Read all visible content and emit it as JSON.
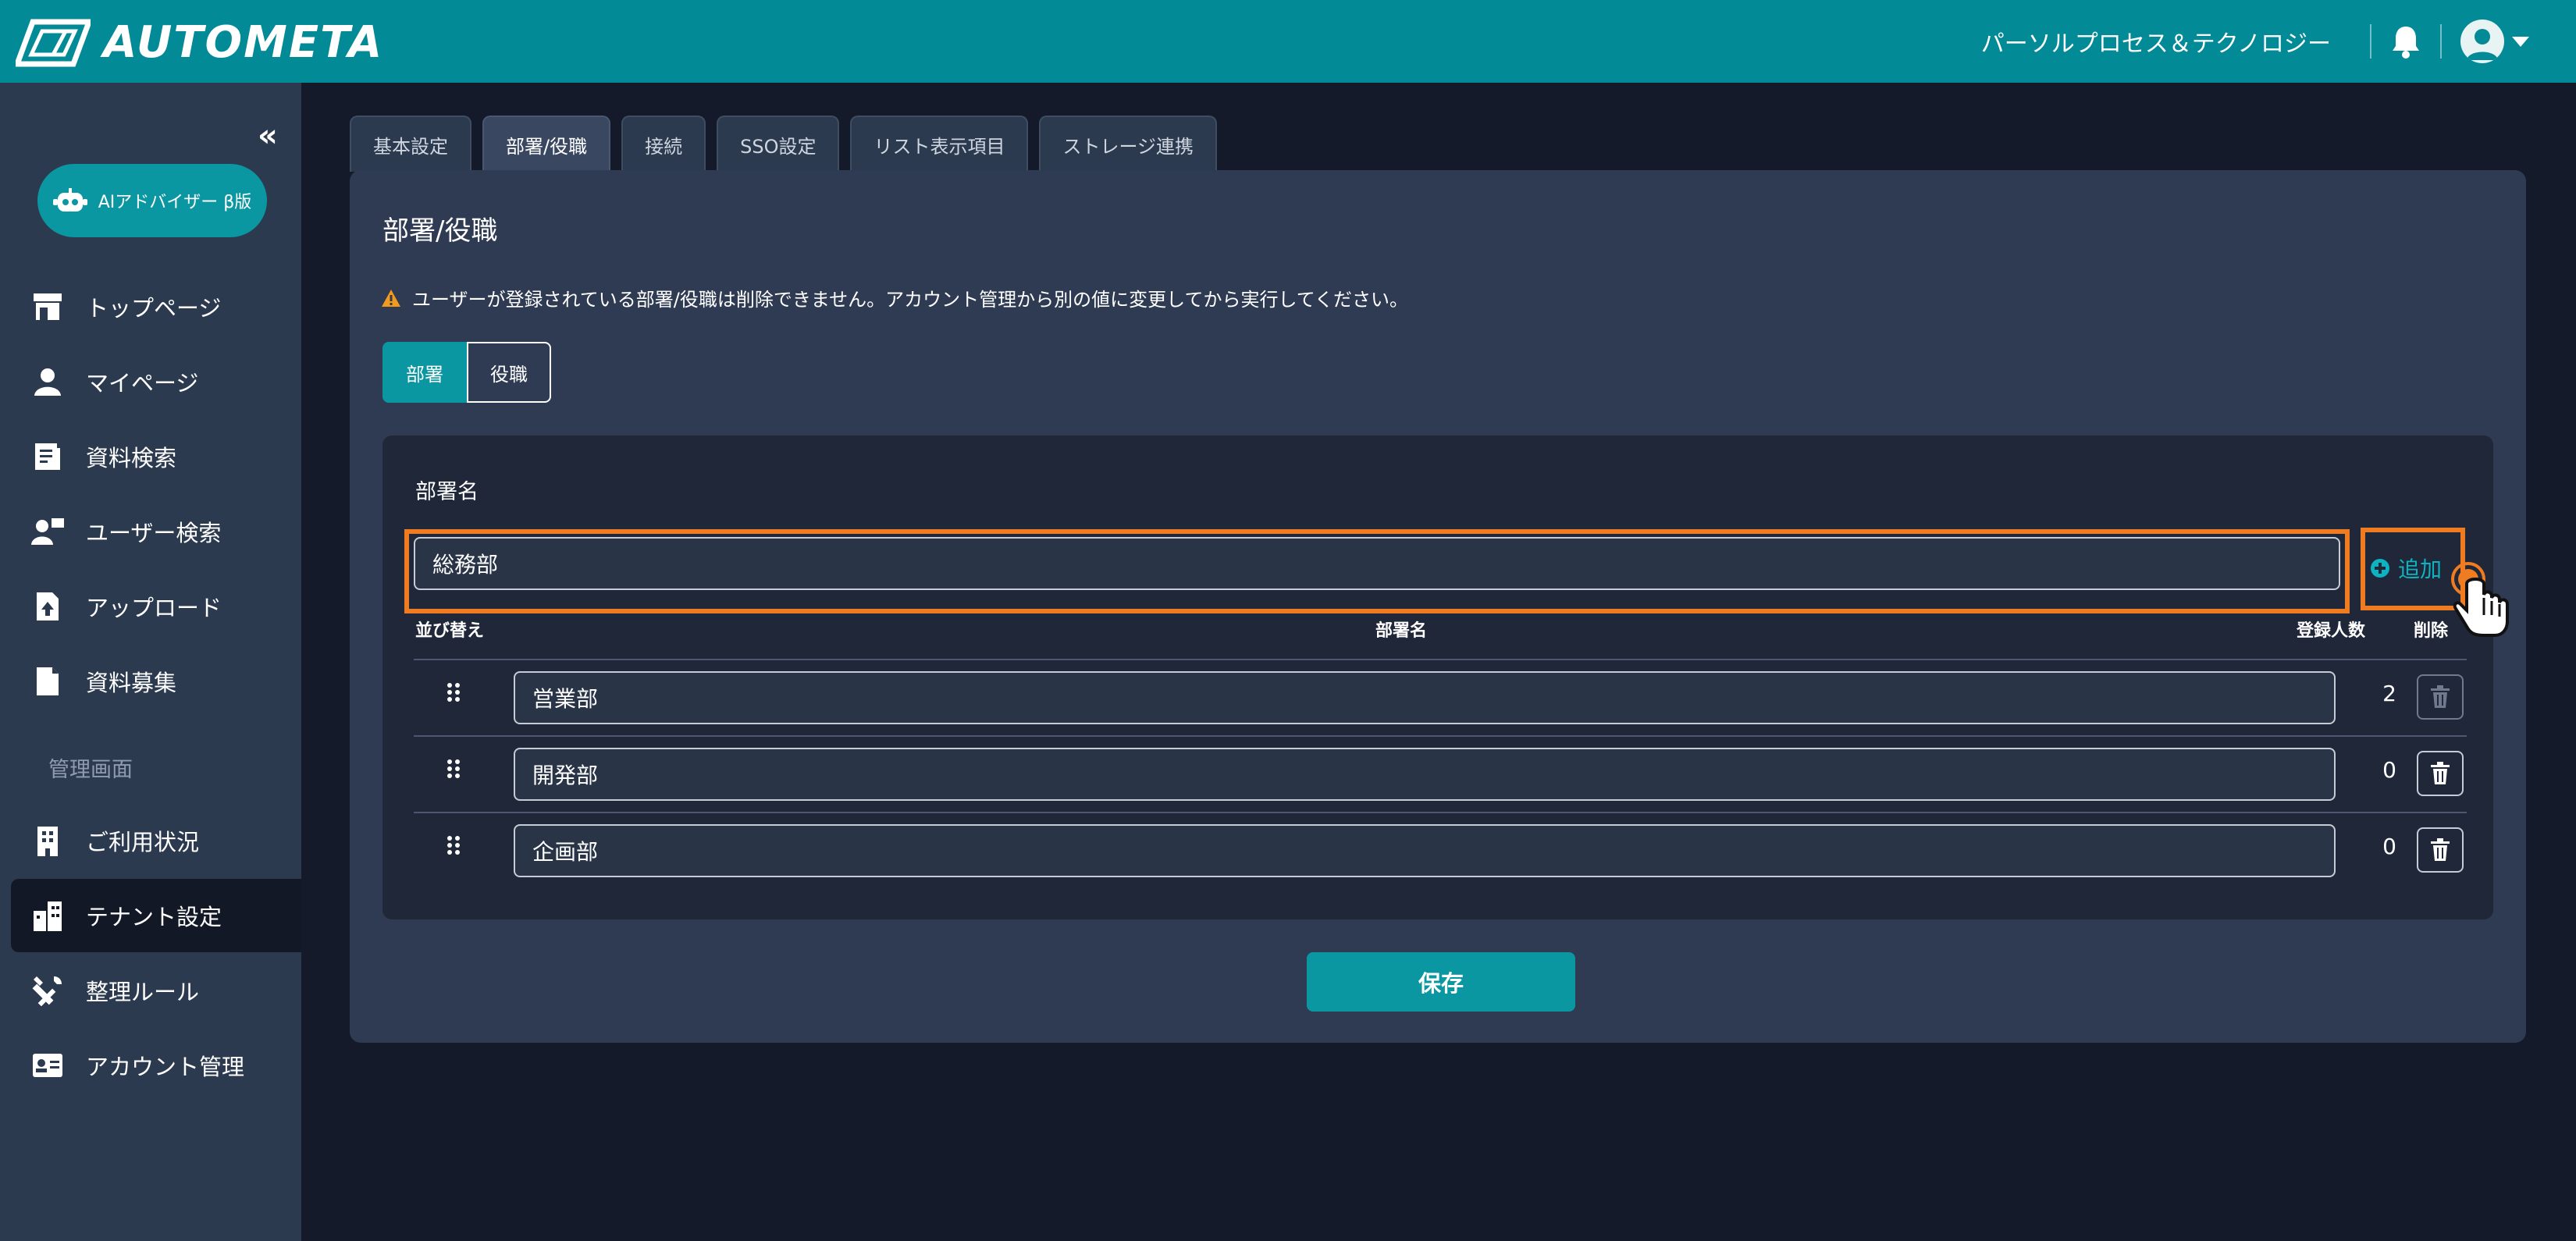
{
  "header": {
    "brand": "AUTOMETA",
    "organization": "パーソルプロセス＆テクノロジー"
  },
  "sidebar": {
    "ai_button": "AIアドバイザー β版",
    "section_admin": "管理画面",
    "items": [
      {
        "label": "トップページ",
        "icon": "store-icon"
      },
      {
        "label": "マイページ",
        "icon": "user-icon"
      },
      {
        "label": "資料検索",
        "icon": "document-search-icon"
      },
      {
        "label": "ユーザー検索",
        "icon": "user-search-icon"
      },
      {
        "label": "アップロード",
        "icon": "upload-file-icon"
      },
      {
        "label": "資料募集",
        "icon": "file-icon"
      },
      {
        "label": "ご利用状況",
        "icon": "building-icon"
      },
      {
        "label": "テナント設定",
        "icon": "tenant-building-icon"
      },
      {
        "label": "整理ルール",
        "icon": "tools-icon"
      },
      {
        "label": "アカウント管理",
        "icon": "id-card-icon"
      }
    ],
    "active_item": "テナント設定"
  },
  "tabs": [
    "基本設定",
    "部署/役職",
    "接続",
    "SSO設定",
    "リスト表示項目",
    "ストレージ連携"
  ],
  "active_tab": "部署/役職",
  "main": {
    "title": "部署/役職",
    "warning": "ユーザーが登録されている部署/役職は削除できません。アカウント管理から別の値に変更してから実行してください。",
    "segments": [
      "部署",
      "役職"
    ],
    "active_segment": "部署",
    "field_label": "部署名",
    "input_value": "総務部",
    "add_label": "追加",
    "columns": {
      "sort": "並び替え",
      "name": "部署名",
      "count": "登録人数",
      "delete": "削除"
    },
    "rows": [
      {
        "name": "営業部",
        "count": "2",
        "deletable": false
      },
      {
        "name": "開発部",
        "count": "0",
        "deletable": true
      },
      {
        "name": "企画部",
        "count": "0",
        "deletable": true
      }
    ],
    "save_label": "保存"
  },
  "colors": {
    "header": "#028a96",
    "accent": "#0a97a2",
    "highlight": "#f07c22",
    "sidebar": "#2c3a4f",
    "panel": "#2f3b52"
  }
}
